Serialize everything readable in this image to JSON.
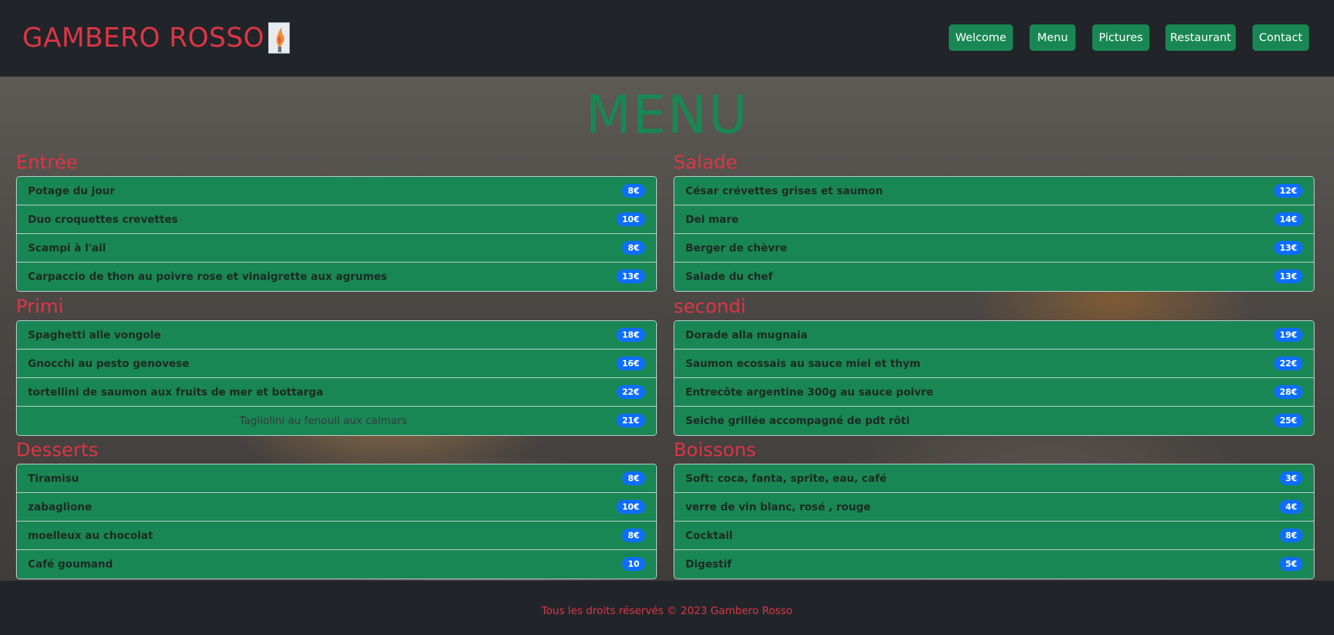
{
  "brand": {
    "name": "GAMBERO ROSSO"
  },
  "nav": [
    "Welcome",
    "Menu",
    "Pictures",
    "Restaurant",
    "Contact"
  ],
  "page_title": "MENU",
  "sections": [
    {
      "title": "Entrée",
      "items": [
        {
          "name": "Potage du jour",
          "price": "8€"
        },
        {
          "name": "Duo croquettes crevettes",
          "price": "10€"
        },
        {
          "name": "Scampi à l'ail",
          "price": "8€"
        },
        {
          "name": "Carpaccio de thon au poivre rose et vinaigrette aux agrumes",
          "price": "13€"
        }
      ]
    },
    {
      "title": "Salade",
      "items": [
        {
          "name": "César crévettes grises et saumon",
          "price": "12€"
        },
        {
          "name": "Del mare",
          "price": "14€"
        },
        {
          "name": "Berger de chèvre",
          "price": "13€"
        },
        {
          "name": "Salade du chef",
          "price": "13€"
        }
      ]
    },
    {
      "title": "Primi",
      "items": [
        {
          "name": "Spaghetti alle vongole",
          "price": "18€"
        },
        {
          "name": "Gnocchi au pesto genovese",
          "price": "16€"
        },
        {
          "name": "tortellini de saumon aux fruits de mer et bottarga",
          "price": "22€"
        },
        {
          "name": "Tagliolini au fenouil aux calmars",
          "price": "21€"
        }
      ]
    },
    {
      "title": "secondi",
      "items": [
        {
          "name": "Dorade alla mugnaia",
          "price": "19€"
        },
        {
          "name": "Saumon ecossais au sauce miel et thym",
          "price": "22€"
        },
        {
          "name": "Entrecôte argentine 300g au sauce poivre",
          "price": "28€"
        },
        {
          "name": "Seiche grillée accompagné de pdt rôti",
          "price": "25€"
        }
      ]
    },
    {
      "title": "Desserts",
      "items": [
        {
          "name": "Tiramisu",
          "price": "8€"
        },
        {
          "name": "zabaglione",
          "price": "10€"
        },
        {
          "name": "moelleux au chocolat",
          "price": "8€"
        },
        {
          "name": "Café goumand",
          "price": "10"
        }
      ]
    },
    {
      "title": "Boissons",
      "items": [
        {
          "name": "Soft: coca, fanta, sprite, eau, café",
          "price": "3€"
        },
        {
          "name": "verre de vin blanc, rosé , rouge",
          "price": "4€"
        },
        {
          "name": "Cocktail",
          "price": "8€"
        },
        {
          "name": "Digestif",
          "price": "5€"
        }
      ]
    }
  ],
  "footer": "Tous les droits réservés © 2023 Gambero Rosso",
  "colors": {
    "brand_red": "#dc3545",
    "button_green": "#198754",
    "badge_blue": "#0d6efd",
    "dark_bg": "#212529"
  }
}
